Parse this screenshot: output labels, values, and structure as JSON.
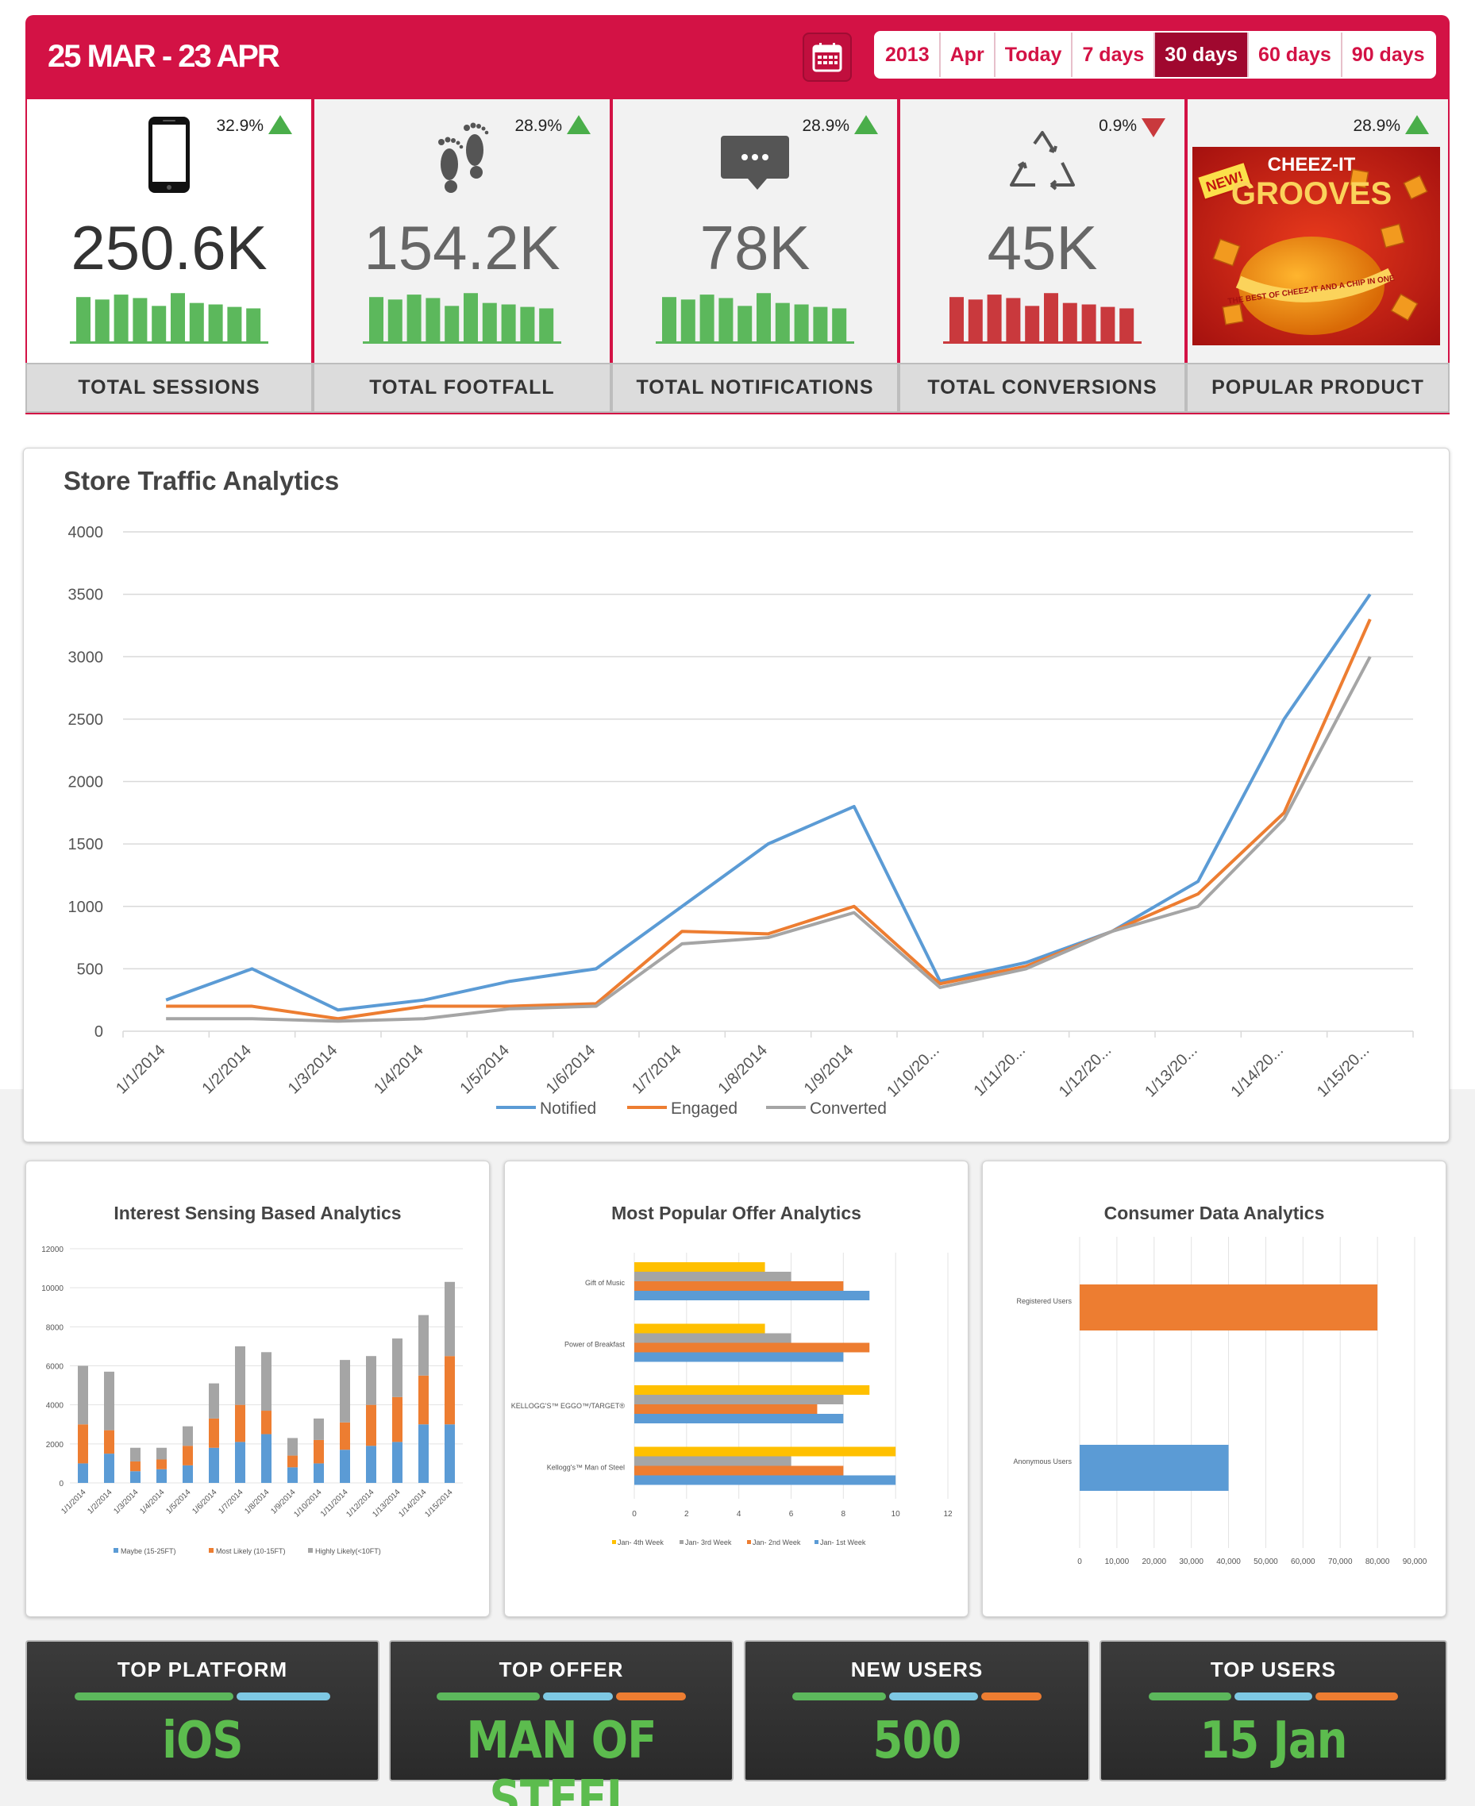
{
  "header": {
    "date_range": "25 MAR - 23 APR",
    "calendar_icon": "calendar-icon",
    "tabs": [
      {
        "label": "2013",
        "active": false
      },
      {
        "label": "Apr",
        "active": false
      },
      {
        "label": "Today",
        "active": false
      },
      {
        "label": "7 days",
        "active": false
      },
      {
        "label": "30 days",
        "active": true
      },
      {
        "label": "60 days",
        "active": false
      },
      {
        "label": "90 days",
        "active": false
      }
    ],
    "accent_color": "#d31245"
  },
  "kpis": [
    {
      "label": "TOTAL SESSIONS",
      "value": "250.6K",
      "change": "32.9%",
      "trend": "up",
      "icon": "smartphone-icon",
      "spark": [
        0.9,
        0.85,
        0.95,
        0.88,
        0.72,
        0.98,
        0.78,
        0.75,
        0.7,
        0.67
      ]
    },
    {
      "label": "TOTAL FOOTFALL",
      "value": "154.2K",
      "change": "28.9%",
      "trend": "up",
      "icon": "footprints-icon",
      "spark": [
        0.9,
        0.85,
        0.95,
        0.88,
        0.72,
        0.98,
        0.78,
        0.75,
        0.7,
        0.67
      ]
    },
    {
      "label": "TOTAL NOTIFICATIONS",
      "value": "78K",
      "change": "28.9%",
      "trend": "up",
      "icon": "chat-bubble-icon",
      "spark": [
        0.9,
        0.85,
        0.95,
        0.88,
        0.72,
        0.98,
        0.78,
        0.75,
        0.7,
        0.67
      ]
    },
    {
      "label": "TOTAL CONVERSIONS",
      "value": "45K",
      "change": "0.9%",
      "trend": "down",
      "icon": "recycle-icon",
      "spark": [
        0.9,
        0.85,
        0.95,
        0.88,
        0.72,
        0.98,
        0.78,
        0.75,
        0.7,
        0.67
      ]
    },
    {
      "label": "POPULAR PRODUCT",
      "value": "",
      "change": "28.9%",
      "trend": "up",
      "icon": "product-image",
      "product_text": [
        "NEW!",
        "CHEEZ-IT",
        "GROOVES",
        "THE BEST OF CHEEZ-IT AND A CHIP IN ONE"
      ]
    }
  ],
  "colors": {
    "up": "#4aae4a",
    "down": "#c9393d",
    "bar_green": "#5cb85c",
    "bar_red": "#c9393d"
  },
  "traffic": {
    "title": "Store Traffic Analytics",
    "chart_data": {
      "type": "line",
      "x": [
        "1/1/2014",
        "1/2/2014",
        "1/3/2014",
        "1/4/2014",
        "1/5/2014",
        "1/6/2014",
        "1/7/2014",
        "1/8/2014",
        "1/9/2014",
        "1/10/20...",
        "1/11/20...",
        "1/12/20...",
        "1/13/20...",
        "1/14/20...",
        "1/15/20..."
      ],
      "series": [
        {
          "name": "Notified",
          "color": "#5b9bd5",
          "values": [
            250,
            500,
            170,
            250,
            400,
            500,
            1000,
            1500,
            1800,
            400,
            550,
            800,
            1200,
            2500,
            3500
          ]
        },
        {
          "name": "Engaged",
          "color": "#ed7d31",
          "values": [
            200,
            200,
            100,
            200,
            200,
            220,
            800,
            780,
            1000,
            380,
            520,
            800,
            1100,
            1750,
            3300
          ]
        },
        {
          "name": "Converted",
          "color": "#a5a5a5",
          "values": [
            100,
            100,
            80,
            100,
            180,
            200,
            700,
            750,
            950,
            350,
            500,
            800,
            1000,
            1700,
            3000
          ]
        }
      ],
      "yticks": [
        "0",
        "500",
        "1000",
        "1500",
        "2000",
        "2500",
        "3000",
        "3500",
        "4000"
      ],
      "ylim": [
        0,
        4000
      ],
      "legend": "bottom",
      "grid": true
    }
  },
  "interest": {
    "title": "Interest Sensing Based Analytics",
    "chart_data": {
      "type": "bar",
      "stacked": true,
      "categories": [
        "1/1/2014",
        "1/2/2014",
        "1/3/2014",
        "1/4/2014",
        "1/5/2014",
        "1/6/2014",
        "1/7/2014",
        "1/8/2014",
        "1/9/2014",
        "1/10/2014",
        "1/11/2014",
        "1/12/2014",
        "1/13/2014",
        "1/14/2014",
        "1/15/2014"
      ],
      "series": [
        {
          "name": "Maybe (15-25FT)",
          "color": "#5b9bd5",
          "values": [
            1000,
            1500,
            600,
            700,
            900,
            1800,
            2100,
            2500,
            800,
            1000,
            1700,
            1900,
            2100,
            3000,
            3000
          ]
        },
        {
          "name": "Most Likely (10-15FT)",
          "color": "#ed7d31",
          "values": [
            2000,
            1200,
            500,
            500,
            1000,
            1500,
            1900,
            1200,
            600,
            1200,
            1400,
            2100,
            2300,
            2500,
            3500
          ]
        },
        {
          "name": "Highly Likely(<10FT)",
          "color": "#a5a5a5",
          "values": [
            3000,
            3000,
            700,
            600,
            1000,
            1800,
            3000,
            3000,
            900,
            1100,
            3200,
            2500,
            3000,
            3100,
            3800
          ]
        }
      ],
      "yticks": [
        "0",
        "2000",
        "4000",
        "6000",
        "8000",
        "10000",
        "12000"
      ],
      "ylim": [
        0,
        12000
      ],
      "legend": "bottom"
    }
  },
  "offer": {
    "title": "Most Popular Offer Analytics",
    "chart_data": {
      "type": "bar",
      "orientation": "horizontal",
      "categories": [
        "Gift of Music",
        "Power of Breakfast",
        "KELLOGG'S™ EGGO™/TARGET®",
        "Kellogg's™ Man of Steel"
      ],
      "series": [
        {
          "name": "Jan- 4th Week",
          "color": "#ffc000",
          "values": [
            5,
            5,
            9,
            10
          ]
        },
        {
          "name": "Jan- 3rd Week",
          "color": "#a5a5a5",
          "values": [
            6,
            6,
            8,
            6
          ]
        },
        {
          "name": "Jan- 2nd Week",
          "color": "#ed7d31",
          "values": [
            8,
            9,
            7,
            8
          ]
        },
        {
          "name": "Jan- 1st Week",
          "color": "#5b9bd5",
          "values": [
            9,
            8,
            8,
            10
          ]
        }
      ],
      "xticks": [
        "0",
        "2",
        "4",
        "6",
        "8",
        "10",
        "12"
      ],
      "xlim": [
        0,
        12
      ],
      "legend": "bottom"
    }
  },
  "consumer": {
    "title": "Consumer Data Analytics",
    "chart_data": {
      "type": "bar",
      "orientation": "horizontal",
      "categories": [
        "Registered Users",
        "Anonymous Users"
      ],
      "values": [
        80000,
        40000
      ],
      "colors": [
        "#ed7d31",
        "#5b9bd5"
      ],
      "xticks": [
        "0",
        "10,000",
        "20,000",
        "30,000",
        "40,000",
        "50,000",
        "60,000",
        "70,000",
        "80,000",
        "90,000"
      ],
      "xlim": [
        0,
        90000
      ]
    }
  },
  "bottom_tiles": [
    {
      "title": "TOP PLATFORM",
      "value": "iOS"
    },
    {
      "title": "TOP OFFER",
      "value": "MAN OF STEEL"
    },
    {
      "title": "NEW USERS",
      "value": "500"
    },
    {
      "title": "TOP USERS",
      "value": "15 Jan"
    }
  ]
}
